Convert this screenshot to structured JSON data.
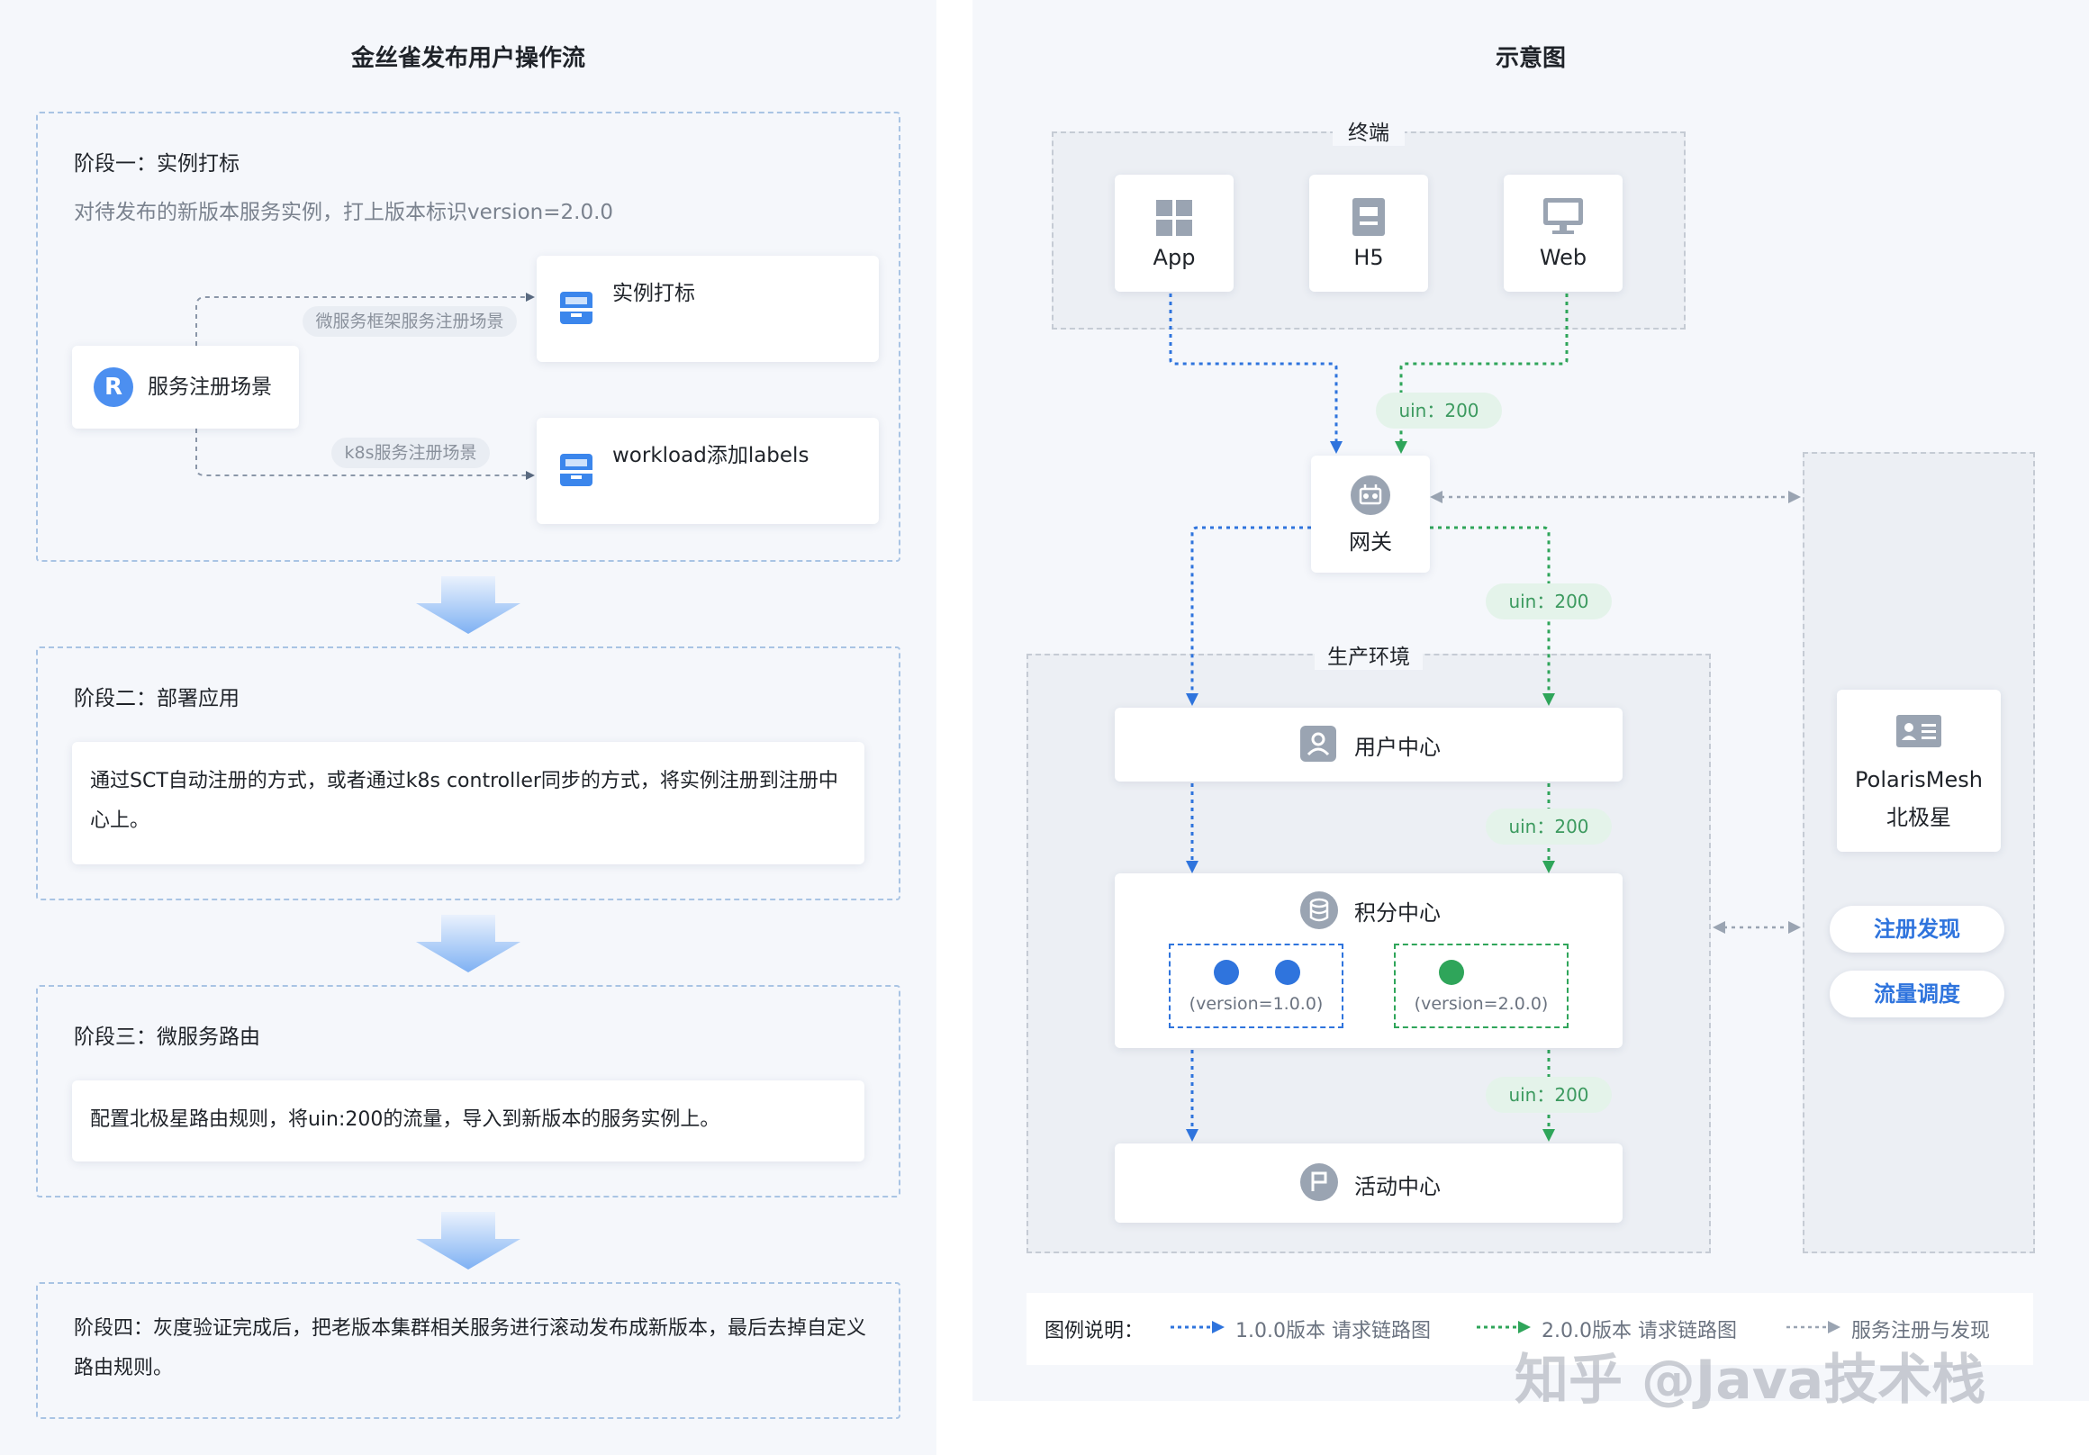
{
  "left": {
    "title": "金丝雀发布用户操作流",
    "stage1": {
      "title": "阶段一：实例打标",
      "subtitle": "对待发布的新版本服务实例，打上版本标识version=2.0.0",
      "source": "服务注册场景",
      "branch_top_label": "微服务框架服务注册场景",
      "branch_bottom_label": "k8s服务注册场景",
      "target_top": "实例打标",
      "target_bottom": "workload添加labels"
    },
    "stage2": {
      "title": "阶段二：部署应用",
      "text": "通过SCT自动注册的方式，或者通过k8s controller同步的方式，将实例注册到注册中心上。"
    },
    "stage3": {
      "title": "阶段三：微服务路由",
      "text": "配置北极星路由规则，将uin:200的流量，导入到新版本的服务实例上。"
    },
    "stage4": {
      "text": "阶段四：灰度验证完成后，把老版本集群相关服务进行滚动发布成新版本，最后去掉自定义路由规则。"
    }
  },
  "right": {
    "title": "示意图",
    "terminal": {
      "title": "终端",
      "items": [
        {
          "label": "App",
          "icon": "grid-icon"
        },
        {
          "label": "H5",
          "icon": "document-icon"
        },
        {
          "label": "Web",
          "icon": "monitor-icon"
        }
      ]
    },
    "gateway": {
      "label": "网关",
      "icon": "gateway-icon"
    },
    "production": {
      "title": "生产环境",
      "user_center": "用户中心",
      "points_center": "积分中心",
      "activity_center": "活动中心",
      "version_old": "(version=1.0.0)",
      "version_new": "(version=2.0.0)"
    },
    "uin_labels": [
      "uin：200",
      "uin：200",
      "uin：200",
      "uin：200"
    ],
    "polaris": {
      "name": "PolarisMesh",
      "name_cn": "北极星",
      "feature1": "注册发现",
      "feature2": "流量调度"
    },
    "legend": {
      "title": "图例说明：",
      "blue": "1.0.0版本 请求链路图",
      "green": "2.0.0版本 请求链路图",
      "gray": "服务注册与发现"
    },
    "watermark": "知乎 @Java技术栈"
  },
  "colors": {
    "blue": "#2f74dd",
    "green": "#2fa55a",
    "gray": "#9aa4b2",
    "dashed_border": "#a9c4e4",
    "panel_bg": "#f5f7fb"
  }
}
